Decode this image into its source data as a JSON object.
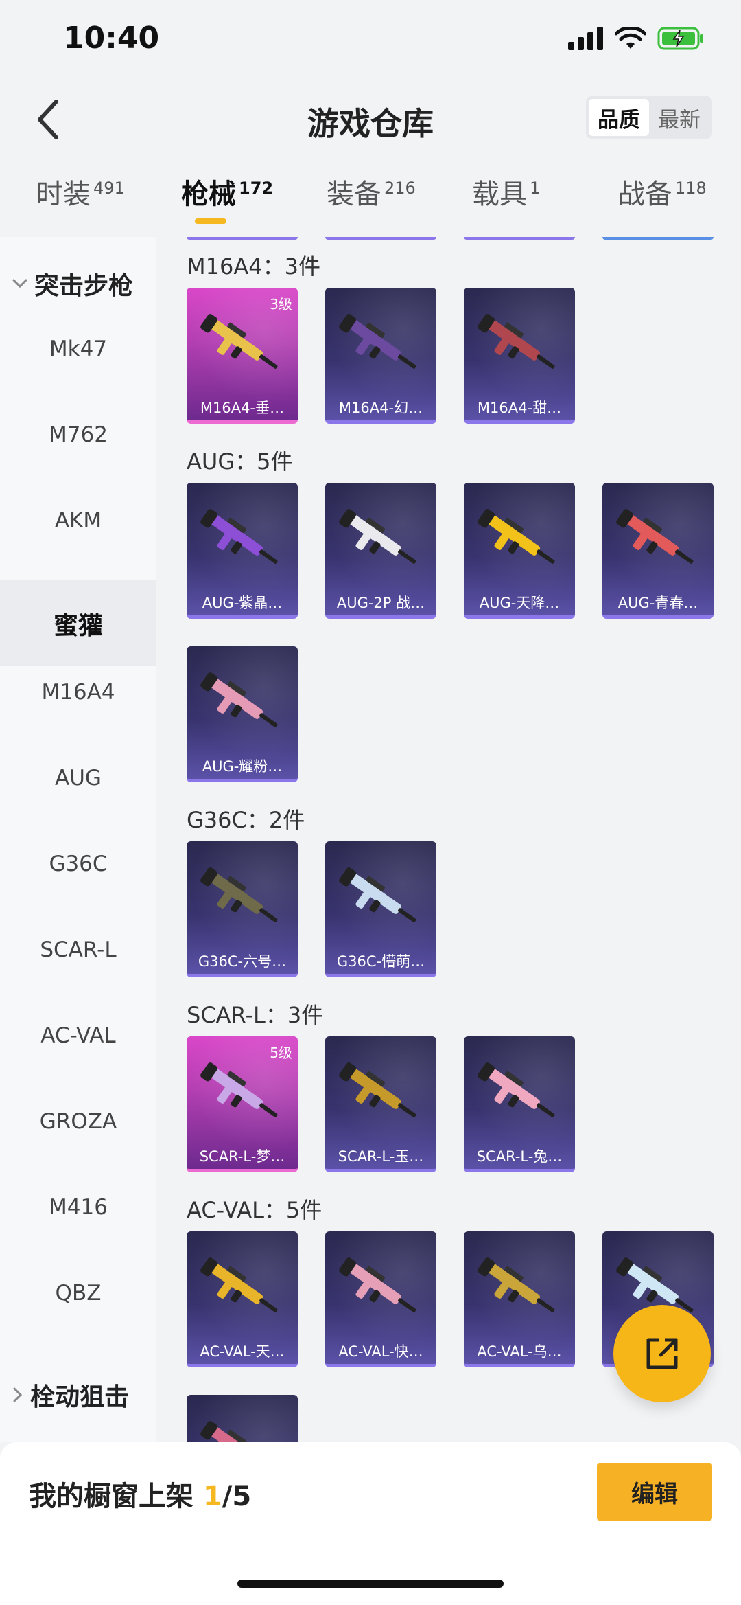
{
  "status_bar": {
    "time": "10:40"
  },
  "header": {
    "title": "游戏仓库",
    "sort_options": [
      "品质",
      "最新"
    ],
    "sort_active": "品质"
  },
  "tabs": [
    {
      "label": "时装",
      "count": "491"
    },
    {
      "label": "枪械",
      "count": "172"
    },
    {
      "label": "装备",
      "count": "216"
    },
    {
      "label": "载具",
      "count": "1"
    },
    {
      "label": "战备",
      "count": "118"
    }
  ],
  "sidebar": {
    "group_expanded": "突击步枪",
    "items": [
      "Mk47",
      "M762",
      "AKM",
      "蜜獾",
      "M16A4",
      "AUG",
      "G36C",
      "SCAR-L",
      "AC-VAL",
      "GROZA",
      "M416",
      "QBZ"
    ],
    "active_item": "蜜獾",
    "group_collapsed": "栓动狙击"
  },
  "sections": [
    {
      "title": "M16A4：3件",
      "cards": [
        {
          "label": "M16A4-垂…",
          "level": "3级",
          "rarity": "pink",
          "gun_color": "#e8c24a"
        },
        {
          "label": "M16A4-幻…",
          "level": "",
          "rarity": "purple",
          "gun_color": "#6b4aa0"
        },
        {
          "label": "M16A4-甜…",
          "level": "",
          "rarity": "purple",
          "gun_color": "#b0474f"
        }
      ]
    },
    {
      "title": "AUG：5件",
      "cards": [
        {
          "label": "AUG-紫晶…",
          "level": "",
          "rarity": "purple",
          "gun_color": "#8c4fd6"
        },
        {
          "label": "AUG-2P 战…",
          "level": "",
          "rarity": "purple",
          "gun_color": "#e9e9ee"
        },
        {
          "label": "AUG-天降…",
          "level": "",
          "rarity": "purple",
          "gun_color": "#f2c21a"
        },
        {
          "label": "AUG-青春…",
          "level": "",
          "rarity": "purple",
          "gun_color": "#e25a5a"
        },
        {
          "label": "AUG-耀粉…",
          "level": "",
          "rarity": "purple",
          "gun_color": "#e59ab5"
        }
      ]
    },
    {
      "title": "G36C：2件",
      "cards": [
        {
          "label": "G36C-六号…",
          "level": "",
          "rarity": "purple",
          "gun_color": "#6e6a4a"
        },
        {
          "label": "G36C-懵萌…",
          "level": "",
          "rarity": "purple",
          "gun_color": "#c9dcef"
        }
      ]
    },
    {
      "title": "SCAR-L：3件",
      "cards": [
        {
          "label": "SCAR-L-梦…",
          "level": "5级",
          "rarity": "pink",
          "gun_color": "#c9a8e8"
        },
        {
          "label": "SCAR-L-玉…",
          "level": "",
          "rarity": "purple",
          "gun_color": "#c59a2a"
        },
        {
          "label": "SCAR-L-兔…",
          "level": "",
          "rarity": "purple",
          "gun_color": "#f0a8c0"
        }
      ]
    },
    {
      "title": "AC-VAL：5件",
      "cards": [
        {
          "label": "AC-VAL-天…",
          "level": "",
          "rarity": "purple",
          "gun_color": "#e8b52a"
        },
        {
          "label": "AC-VAL-快…",
          "level": "",
          "rarity": "purple",
          "gun_color": "#e5a0b8"
        },
        {
          "label": "AC-VAL-乌…",
          "level": "",
          "rarity": "purple",
          "gun_color": "#c9a53a"
        },
        {
          "label": "A…",
          "level": "",
          "rarity": "purple",
          "gun_color": "#cfe6f5"
        },
        {
          "label": "",
          "level": "",
          "rarity": "purple",
          "gun_color": "#d76a8a"
        }
      ]
    }
  ],
  "bottom_bar": {
    "shelf_label": "我的橱窗上架",
    "shelf_count": "1",
    "shelf_total": "/5",
    "edit_label": "编辑"
  },
  "colors": {
    "accent": "#f5b821",
    "card_purple": "#38336e",
    "card_pink": "#c43fc0"
  }
}
